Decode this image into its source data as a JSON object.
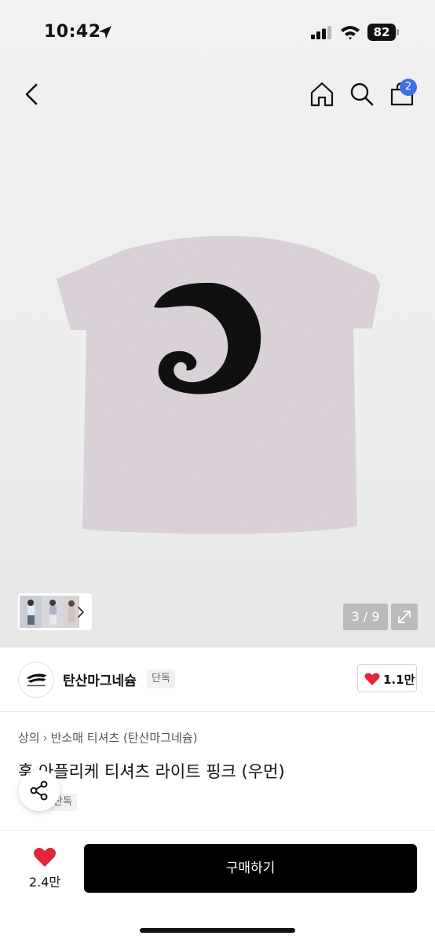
{
  "status_bar": {
    "time": "10:42",
    "battery": "82"
  },
  "header": {
    "cart_count": "2"
  },
  "gallery": {
    "page_indicator": "3 / 9"
  },
  "shop": {
    "name": "탄산마그네슘",
    "badge": "단독",
    "like_count": "1.1만"
  },
  "product": {
    "breadcrumb": [
      "상의",
      "반소매 티셔츠 (탄산마그네슘)"
    ],
    "title": "훅 아플리케 티셔츠 라이트 핑크 (우먼)",
    "tag": "단독"
  },
  "bottom_bar": {
    "wish_count": "2.4만",
    "buy_label": "구매하기"
  },
  "colors": {
    "accent_blue": "#3f6ee8",
    "heart_red": "#e5243b",
    "buy_button": "#000000",
    "shirt": "#ddd3da"
  },
  "icons": [
    "location-arrow-icon",
    "signal-icon",
    "wifi-icon",
    "back-icon",
    "home-icon",
    "search-icon",
    "shopping-bag-icon",
    "chevron-right-icon",
    "expand-icon",
    "heart-icon",
    "share-icon"
  ]
}
